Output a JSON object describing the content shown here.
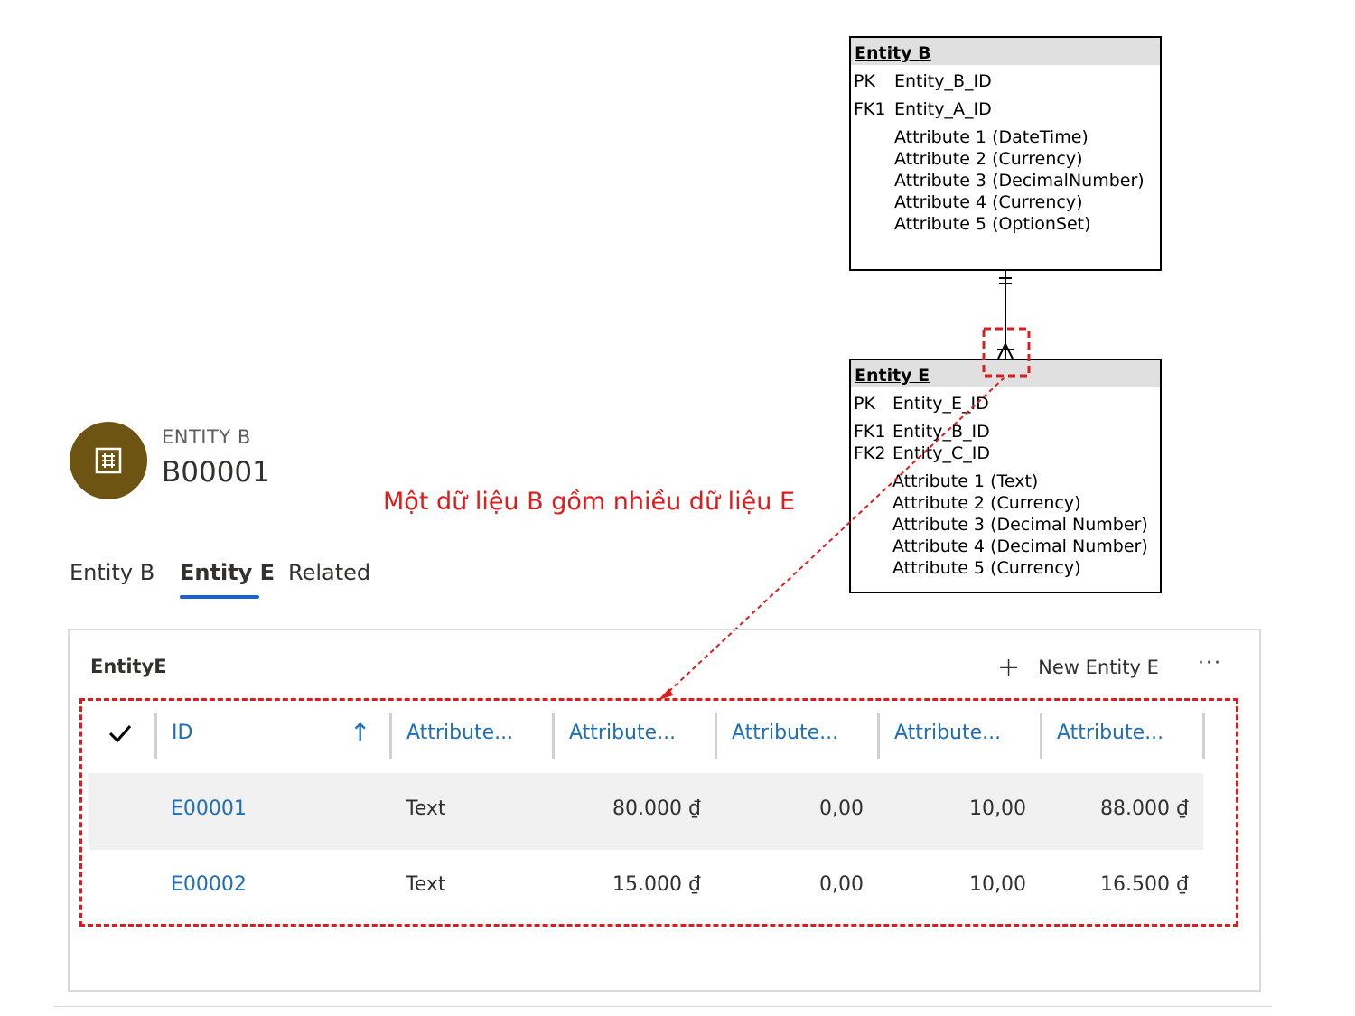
{
  "diagram": {
    "entity_b": {
      "title": "Entity B",
      "pk_label": "PK",
      "pk_field": "Entity_B_ID",
      "fk1_label": "FK1",
      "fk1_field": "Entity_A_ID",
      "attributes": [
        "Attribute 1 (DateTime)",
        "Attribute 2 (Currency)",
        "Attribute 3 (DecimalNumber)",
        "Attribute 4 (Currency)",
        "Attribute 5 (OptionSet)"
      ]
    },
    "entity_e": {
      "title": "Entity E",
      "pk_label": "PK",
      "pk_field": "Entity_E_ID",
      "fk1_label": "FK1",
      "fk1_field": "Entity_B_ID",
      "fk2_label": "FK2",
      "fk2_field": "Entity_C_ID",
      "attributes": [
        "Attribute 1 (Text)",
        "Attribute 2 (Currency)",
        "Attribute 3 (Decimal Number)",
        "Attribute 4 (Decimal Number)",
        "Attribute 5 (Currency)"
      ]
    },
    "annotation": "Một dữ liệu B gồm nhiều dữ liệu E",
    "annotation_color": "#e01b1b"
  },
  "record": {
    "entity_kind": "ENTITY B",
    "record_id": "B00001",
    "avatar_color": "#6e5412",
    "avatar_icon": "entity-icon"
  },
  "tabs": [
    "Entity B",
    "Entity E",
    "Related"
  ],
  "active_tab": "Entity E",
  "subgrid": {
    "title": "EntityE",
    "new_button": "New Entity E",
    "more_button": "···",
    "columns": [
      "ID",
      "Attribute...",
      "Attribute...",
      "Attribute...",
      "Attribute...",
      "Attribute..."
    ],
    "sort_icon": "sort-ascending-icon",
    "rows": [
      [
        "E00001",
        "Text",
        "80.000 ₫",
        "0,00",
        "10,00",
        "88.000 ₫"
      ],
      [
        "E00002",
        "Text",
        "15.000 ₫",
        "0,00",
        "10,00",
        "16.500 ₫"
      ]
    ],
    "link_color": "#1c6fb8"
  }
}
